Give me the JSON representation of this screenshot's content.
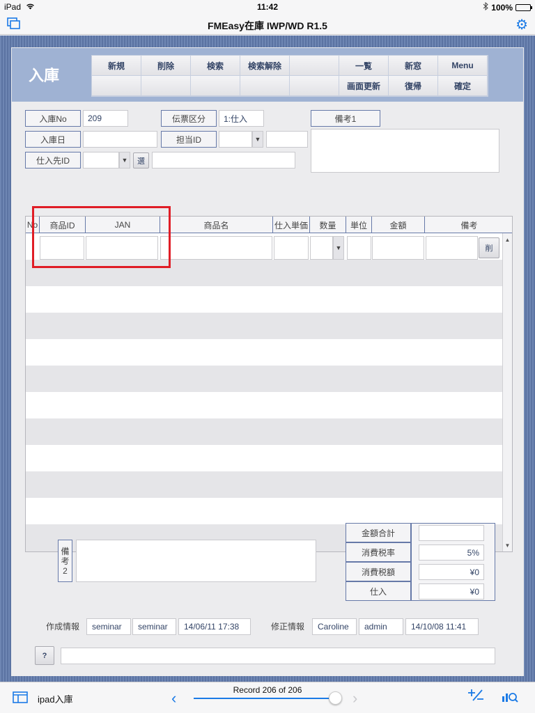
{
  "status_bar": {
    "device": "iPad",
    "time": "11:42",
    "battery": "100%"
  },
  "nav": {
    "title": "FMEasy在庫 IWP/WD R1.5"
  },
  "form": {
    "title": "入庫",
    "buttons_row1": [
      "新規",
      "削除",
      "検索",
      "検索解除",
      "",
      "一覧",
      "新窓",
      "Menu"
    ],
    "buttons_row2": [
      "",
      "",
      "",
      "",
      "",
      "画面更新",
      "復帰",
      "確定"
    ],
    "fields": {
      "nyuko_no_label": "入庫No",
      "nyuko_no_value": "209",
      "nyuko_date_label": "入庫日",
      "nyuko_date_value": "",
      "supplier_label": "仕入先ID",
      "supplier_value": "",
      "select_button": "選",
      "denpyo_label": "伝票区分",
      "denpyo_value": "1:仕入",
      "tanto_label": "担当ID",
      "tanto_value": "",
      "biko1_label": "備考1",
      "biko1_value": ""
    },
    "table": {
      "headers": [
        "No",
        "商品ID",
        "JAN",
        "商品名",
        "仕入単価",
        "数量",
        "単位",
        "金額",
        "備考"
      ],
      "delete_button": "削"
    },
    "biko2_label": "備考2",
    "totals": {
      "labels": [
        "金額合計",
        "消費税率",
        "消費税額",
        "仕入"
      ],
      "values": [
        "",
        "5%",
        "¥0",
        "¥0"
      ]
    },
    "info": {
      "created_label": "作成情報",
      "created": [
        "seminar",
        "seminar",
        "14/06/11 17:38"
      ],
      "modified_label": "修正情報",
      "modified": [
        "Caroline",
        "admin",
        "14/10/08 11:41"
      ]
    },
    "help_button": "?"
  },
  "toolbar": {
    "layout_name": "ipad入庫",
    "record_label": "Record 206 of 206",
    "record_position": 1.0
  },
  "colors": {
    "accent": "#1a7ae6",
    "highlight": "#e01d26",
    "header_bg": "#9fb2d3"
  }
}
